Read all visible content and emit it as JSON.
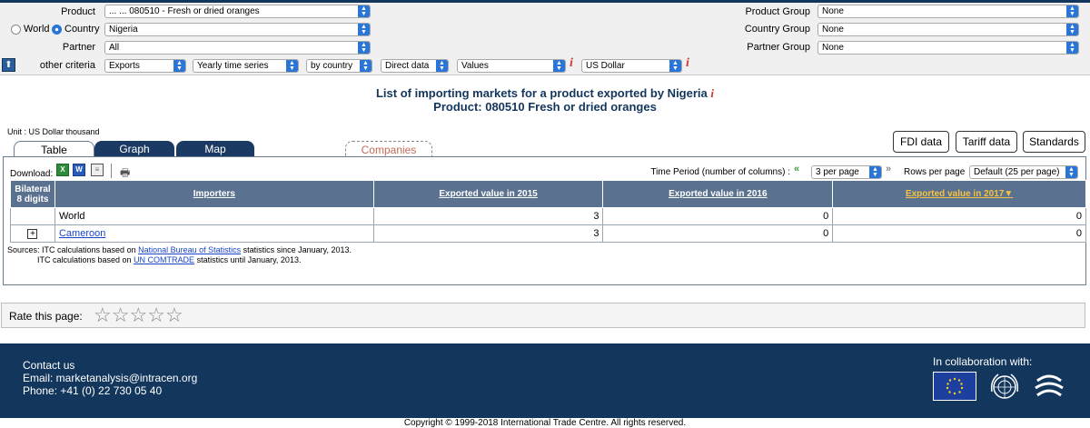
{
  "filters": {
    "product_label": "Product",
    "product_value": "... ... 080510 - Fresh or dried oranges",
    "world_label": "World",
    "country_label": "Country",
    "country_value": "Nigeria",
    "partner_label": "Partner",
    "partner_value": "All",
    "other_criteria_label": "other criteria",
    "criteria": [
      "Exports",
      "Yearly time series",
      "by country",
      "Direct data",
      "Values",
      "US Dollar"
    ],
    "product_group_label": "Product Group",
    "product_group_value": "None",
    "country_group_label": "Country Group",
    "country_group_value": "None",
    "partner_group_label": "Partner Group",
    "partner_group_value": "None"
  },
  "title": {
    "line1": "List of importing markets for a product exported by Nigeria",
    "line2": "Product: 080510 Fresh or dried oranges"
  },
  "unit": "Unit : US Dollar thousand",
  "tabs": [
    "Table",
    "Graph",
    "Map",
    "Companies"
  ],
  "right_buttons": [
    "FDI data",
    "Tariff data",
    "Standards"
  ],
  "toolbar": {
    "download_label": "Download:",
    "time_period_label": "Time Period (number of columns) :",
    "time_period_value": "3 per page",
    "rows_per_page_label": "Rows per page",
    "rows_per_page_value": "Default (25 per page)"
  },
  "table": {
    "headers": [
      "Bilateral 8 digits",
      "Importers",
      "Exported value in 2015",
      "Exported value in 2016",
      "Exported value in 2017"
    ],
    "sort_indicator": "▼",
    "rows": [
      {
        "expander": "",
        "importer": "World",
        "v2015": "3",
        "v2016": "0",
        "v2017": "0"
      },
      {
        "expander": "+",
        "importer": "Cameroon",
        "v2015": "3",
        "v2016": "0",
        "v2017": "0"
      }
    ]
  },
  "sources": {
    "l1_pre": "Sources: ITC calculations based on ",
    "l1_link": "National Bureau of Statistics",
    "l1_post": " statistics since January, 2013.",
    "l2_pre": "ITC calculations based on ",
    "l2_link": "UN COMTRADE",
    "l2_post": " statistics until January, 2013."
  },
  "rating": {
    "label": "Rate this page:",
    "stars": 5
  },
  "footer": {
    "contact": "Contact us",
    "email": "Email: marketanalysis@intracen.org",
    "phone": "Phone: +41 (0) 22 730 05 40",
    "collab": "In collaboration with:",
    "copyright": "Copyright © 1999-2018 International Trade Centre. All rights reserved."
  },
  "colors": {
    "navy": "#13365c",
    "header_blue": "#5a7290",
    "sorted": "#f5c242",
    "info_red": "#d9342b"
  }
}
